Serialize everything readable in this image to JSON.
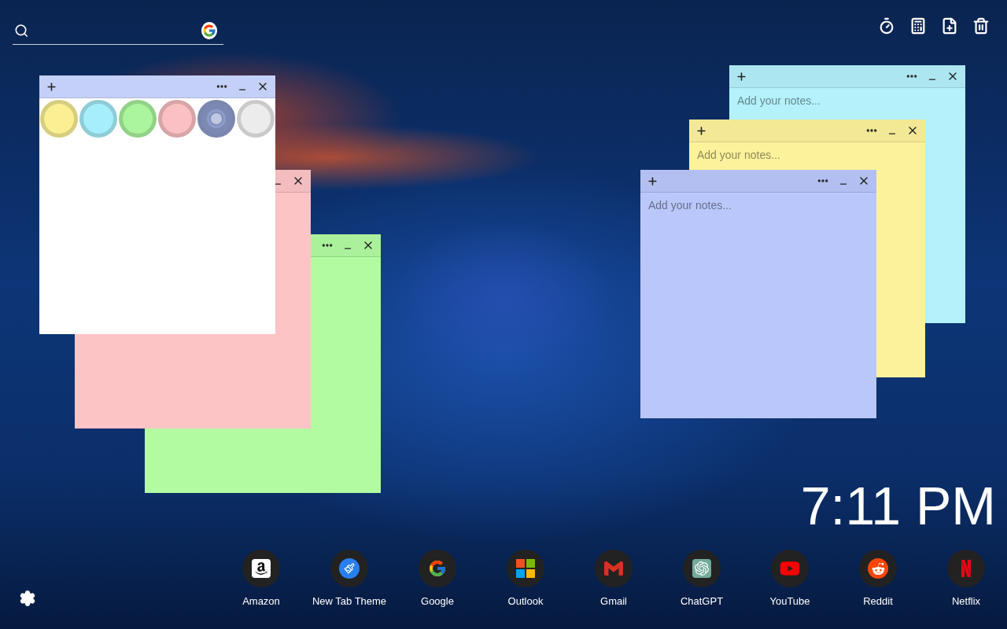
{
  "toolbar": [
    {
      "kind": "timer"
    },
    {
      "kind": "calculator"
    },
    {
      "kind": "new-note"
    },
    {
      "kind": "trash"
    }
  ],
  "notes": [
    {
      "kind": "text",
      "color": "#b3f1fb",
      "placeholder": "Add your notes..."
    },
    {
      "kind": "text",
      "color": "#fdf29c",
      "placeholder": "Add your notes..."
    },
    {
      "kind": "text",
      "color": "#b9c7fa",
      "placeholder": "Add your notes..."
    },
    {
      "kind": "text",
      "color": "#b2fba1"
    },
    {
      "kind": "text",
      "color": "#fdc4c6"
    },
    {
      "kind": "picker",
      "color": "#ffffff",
      "swatches": [
        {
          "color": "#fbef94",
          "selected": false
        },
        {
          "color": "#a6eefb",
          "selected": false
        },
        {
          "color": "#abf59c",
          "selected": false
        },
        {
          "color": "#fbc0c3",
          "selected": false
        },
        {
          "color": "#8e9ccb",
          "selected": true
        },
        {
          "color": "#ececec",
          "selected": false
        }
      ]
    }
  ],
  "clock": "7:11 PM",
  "shortcuts": [
    {
      "kind": "amazon",
      "label": "Amazon"
    },
    {
      "kind": "theme",
      "label": "New Tab Theme"
    },
    {
      "kind": "google",
      "label": "Google"
    },
    {
      "kind": "outlook",
      "label": "Outlook"
    },
    {
      "kind": "gmail",
      "label": "Gmail"
    },
    {
      "kind": "chatgpt",
      "label": "ChatGPT"
    },
    {
      "kind": "youtube",
      "label": "YouTube"
    },
    {
      "kind": "reddit",
      "label": "Reddit"
    },
    {
      "kind": "netflix",
      "label": "Netflix"
    }
  ]
}
